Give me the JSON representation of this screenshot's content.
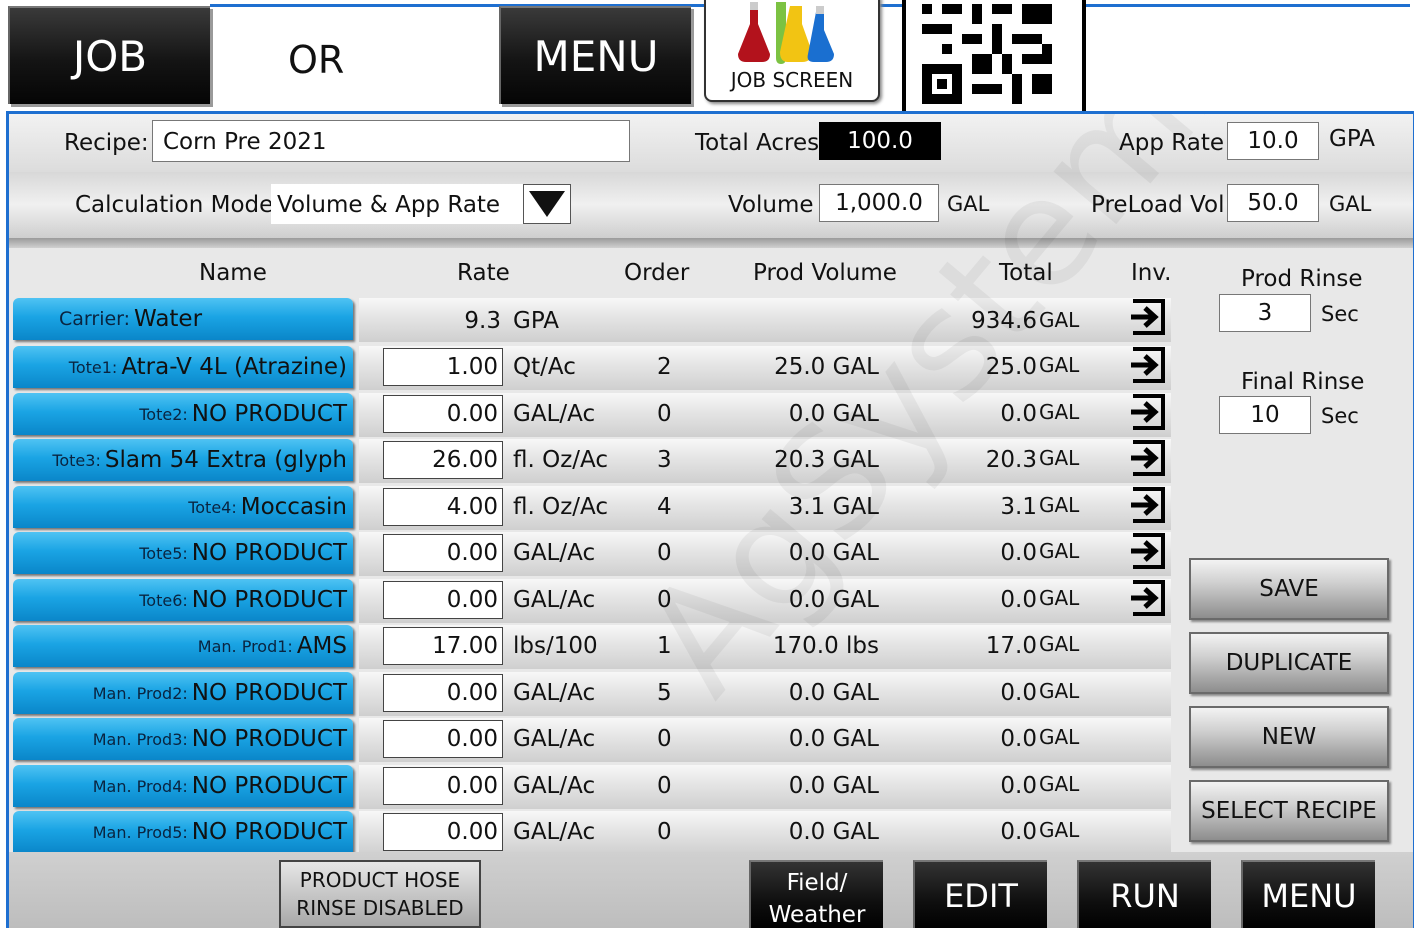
{
  "top": {
    "job_label": "JOB",
    "or_label": "OR",
    "menu_label": "MENU",
    "job_screen_label": "JOB SCREEN"
  },
  "recipe": {
    "recipe_label": "Recipe:",
    "recipe_value": "Corn Pre 2021",
    "total_acres_label": "Total Acres",
    "total_acres_value": "100.0",
    "app_rate_label": "App Rate",
    "app_rate_value": "10.0",
    "app_rate_unit": "GPA",
    "calc_mode_label": "Calculation Mode",
    "calc_mode_value": "Volume & App Rate",
    "volume_label": "Volume",
    "volume_value": "1,000.0",
    "volume_unit": "GAL",
    "preload_label": "PreLoad Vol",
    "preload_value": "50.0",
    "preload_unit": "GAL"
  },
  "table": {
    "headers": {
      "name": "Name",
      "rate": "Rate",
      "order": "Order",
      "prod_volume": "Prod Volume",
      "total": "Total",
      "inv": "Inv."
    },
    "carrier": {
      "prefix": "Carrier:",
      "name": "Water",
      "rate": "9.3",
      "unit": "GPA",
      "total": "934.6",
      "total_unit": "GAL"
    },
    "rows": [
      {
        "prefix": "Tote1:",
        "name": "Atra-V 4L (Atrazine)",
        "rate": "1.00",
        "unit": "Qt/Ac",
        "order": "2",
        "prod_volume": "25.0 GAL",
        "total": "25.0",
        "total_unit": "GAL",
        "inv": true
      },
      {
        "prefix": "Tote2:",
        "name": "NO PRODUCT",
        "rate": "0.00",
        "unit": "GAL/Ac",
        "order": "0",
        "prod_volume": "0.0 GAL",
        "total": "0.0",
        "total_unit": "GAL",
        "inv": true
      },
      {
        "prefix": "Tote3:",
        "name": "Slam 54 Extra (glyph",
        "rate": "26.00",
        "unit": "fl. Oz/Ac",
        "order": "3",
        "prod_volume": "20.3 GAL",
        "total": "20.3",
        "total_unit": "GAL",
        "inv": true
      },
      {
        "prefix": "Tote4:",
        "name": "Moccasin",
        "rate": "4.00",
        "unit": "fl. Oz/Ac",
        "order": "4",
        "prod_volume": "3.1 GAL",
        "total": "3.1",
        "total_unit": "GAL",
        "inv": true
      },
      {
        "prefix": "Tote5:",
        "name": "NO PRODUCT",
        "rate": "0.00",
        "unit": "GAL/Ac",
        "order": "0",
        "prod_volume": "0.0 GAL",
        "total": "0.0",
        "total_unit": "GAL",
        "inv": true
      },
      {
        "prefix": "Tote6:",
        "name": "NO PRODUCT",
        "rate": "0.00",
        "unit": "GAL/Ac",
        "order": "0",
        "prod_volume": "0.0 GAL",
        "total": "0.0",
        "total_unit": "GAL",
        "inv": true
      },
      {
        "prefix": "Man. Prod1:",
        "name": "AMS",
        "rate": "17.00",
        "unit": "lbs/100",
        "order": "1",
        "prod_volume": "170.0 lbs",
        "total": "17.0",
        "total_unit": "GAL",
        "inv": false
      },
      {
        "prefix": "Man. Prod2:",
        "name": "NO PRODUCT",
        "rate": "0.00",
        "unit": "GAL/Ac",
        "order": "5",
        "prod_volume": "0.0 GAL",
        "total": "0.0",
        "total_unit": "GAL",
        "inv": false
      },
      {
        "prefix": "Man. Prod3:",
        "name": "NO PRODUCT",
        "rate": "0.00",
        "unit": "GAL/Ac",
        "order": "0",
        "prod_volume": "0.0 GAL",
        "total": "0.0",
        "total_unit": "GAL",
        "inv": false
      },
      {
        "prefix": "Man. Prod4:",
        "name": "NO PRODUCT",
        "rate": "0.00",
        "unit": "GAL/Ac",
        "order": "0",
        "prod_volume": "0.0 GAL",
        "total": "0.0",
        "total_unit": "GAL",
        "inv": false
      },
      {
        "prefix": "Man. Prod5:",
        "name": "NO PRODUCT",
        "rate": "0.00",
        "unit": "GAL/Ac",
        "order": "0",
        "prod_volume": "0.0 GAL",
        "total": "0.0",
        "total_unit": "GAL",
        "inv": false
      }
    ]
  },
  "side": {
    "prod_rinse_label": "Prod Rinse",
    "prod_rinse_value": "3",
    "prod_rinse_unit": "Sec",
    "final_rinse_label": "Final Rinse",
    "final_rinse_value": "10",
    "final_rinse_unit": "Sec",
    "save_label": "SAVE",
    "duplicate_label": "DUPLICATE",
    "new_label": "NEW",
    "select_recipe_label": "SELECT RECIPE"
  },
  "bottom": {
    "hose_line1": "PRODUCT HOSE",
    "hose_line2": "RINSE DISABLED",
    "field_weather_line1": "Field/",
    "field_weather_line2": "Weather",
    "edit_label": "EDIT",
    "run_label": "RUN",
    "menu_label": "MENU"
  },
  "watermark": "AgSystems",
  "colors": {
    "accent_blue": "#1e6fd0",
    "name_button": "#1aa4e4"
  }
}
